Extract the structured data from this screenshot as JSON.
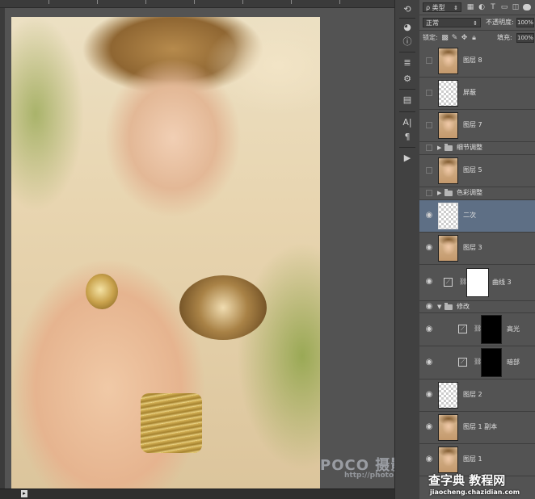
{
  "filter": {
    "kind_label": "ρ 类型",
    "icons": [
      "image-filter-icon",
      "adjustment-filter-icon",
      "type-filter-icon",
      "shape-filter-icon",
      "smart-object-filter-icon"
    ]
  },
  "blend": {
    "mode": "正常",
    "opacity_label": "不透明度:",
    "opacity_value": "100%"
  },
  "lock": {
    "label": "锁定:",
    "fill_label": "填充:",
    "fill_value": "100%"
  },
  "layers": [
    {
      "name": "图层 8",
      "kind": "photo",
      "visible": false
    },
    {
      "name": "屏蔽",
      "kind": "transparent",
      "visible": false
    },
    {
      "name": "图层 7",
      "kind": "photo",
      "visible": false
    },
    {
      "name": "细节调整",
      "kind": "group",
      "visible": false,
      "expanded": false
    },
    {
      "name": "图层 5",
      "kind": "photo",
      "visible": false
    },
    {
      "name": "色彩调整",
      "kind": "group",
      "visible": false,
      "expanded": false
    },
    {
      "name": "二次",
      "kind": "transparent",
      "visible": true,
      "selected": true
    },
    {
      "name": "图层 3",
      "kind": "photo",
      "visible": true
    },
    {
      "name": "曲线 3",
      "kind": "curves",
      "visible": true,
      "mask": "white"
    },
    {
      "name": "修改",
      "kind": "group",
      "visible": true,
      "expanded": true
    },
    {
      "name": "高光",
      "kind": "curves",
      "visible": true,
      "mask": "black",
      "indent": true
    },
    {
      "name": "暗部",
      "kind": "curves",
      "visible": true,
      "mask": "black",
      "indent": true
    },
    {
      "name": "图层 2",
      "kind": "transparent",
      "visible": true
    },
    {
      "name": "图层 1 副本",
      "kind": "photo",
      "visible": true
    },
    {
      "name": "图层 1",
      "kind": "photo",
      "visible": true
    }
  ],
  "watermarks": {
    "poco": "POCO 摄影专题",
    "poco_url": "http://photo.poco.cn/",
    "site": "查字典 教程网",
    "site_url": "jiaocheng.chazidian.com"
  },
  "status": {
    "arrow": "▸"
  }
}
